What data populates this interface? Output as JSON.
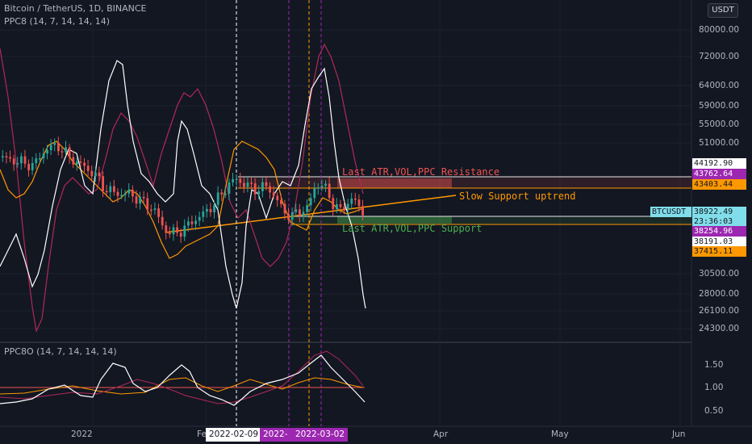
{
  "header": {
    "symbol_title": "Bitcoin / TetherUS, 1D, BINANCE",
    "indicator_main": "PPC8 (14, 7, 14, 14, 14)",
    "indicator_sub": "PPC8O (14, 7, 14, 14, 14)"
  },
  "currency_button": "USDT",
  "price_axis": {
    "labels": [
      "80000.00",
      "72000.00",
      "64000.00",
      "59000.00",
      "55000.00",
      "51000.00",
      "30500.00",
      "28000.00",
      "26100.00",
      "24300.00"
    ]
  },
  "price_badges": [
    {
      "id": "p1",
      "text": "44192.90",
      "bg": "#ffffff",
      "fg": "#131722"
    },
    {
      "id": "p2",
      "text": "43762.64",
      "bg": "#9c27b0",
      "fg": "#ffffff"
    },
    {
      "id": "p3",
      "text": "43403.44",
      "bg": "#ff9800",
      "fg": "#131722"
    },
    {
      "id": "p4",
      "text": "BTCUSDT",
      "bg": "#80deea",
      "fg": "#131722"
    },
    {
      "id": "p5",
      "text": "38922.49",
      "bg": "#80deea",
      "fg": "#131722"
    },
    {
      "id": "p6",
      "text": "23:36:03",
      "bg": "#80deea",
      "fg": "#131722"
    },
    {
      "id": "p7",
      "text": "38254.96",
      "bg": "#9c27b0",
      "fg": "#ffffff"
    },
    {
      "id": "p8",
      "text": "38191.03",
      "bg": "#ffffff",
      "fg": "#131722"
    },
    {
      "id": "p9",
      "text": "37415.11",
      "bg": "#ff9800",
      "fg": "#131722"
    }
  ],
  "oscillator_axis": {
    "labels": [
      "1.50",
      "1.00",
      "0.50"
    ]
  },
  "time_axis": {
    "labels": [
      "2022",
      "Fe",
      "Apr",
      "May",
      "Jun"
    ],
    "badges": [
      {
        "text": "2022-02-09",
        "bg": "#ffffff",
        "fg": "#131722"
      },
      {
        "text": "2022-0",
        "bg": "#9c27b0",
        "fg": "#ffffff"
      },
      {
        "text": "2022-03-02",
        "bg": "#9c27b0",
        "fg": "#ffffff"
      }
    ]
  },
  "annotations": {
    "resistance": "Last ATR,VOL,PPC Resistance",
    "support_uptrend": "Slow Support uptrend",
    "support": "Last ATR,VOL,PPC Support"
  },
  "colors": {
    "background": "#131722",
    "bull": "#26a69a",
    "bear": "#ef5350",
    "white_line": "#ffffff",
    "orange": "#ff9800",
    "maroon": "#b0285a",
    "resistance_text": "#ef5350",
    "support_text": "#4caf50"
  }
}
